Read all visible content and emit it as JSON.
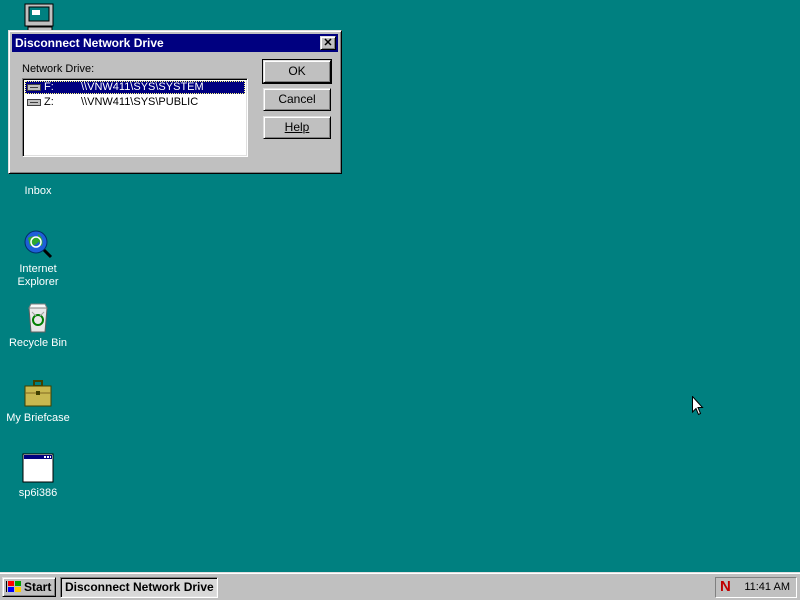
{
  "desktop": {
    "icons": [
      {
        "label": ""
      },
      {
        "label": "Inbox"
      },
      {
        "label": "Internet\nExplorer",
        "line1": "Internet",
        "line2": "Explorer"
      },
      {
        "label": "Recycle Bin"
      },
      {
        "label": "My Briefcase"
      },
      {
        "label": "sp6i386"
      }
    ]
  },
  "dialog": {
    "title": "Disconnect Network Drive",
    "close_label": "✕",
    "list_label": "Network Drive:",
    "drives": [
      {
        "letter": "F:",
        "path": "\\\\VNW411\\SYS\\SYSTEM",
        "selected": true
      },
      {
        "letter": "Z:",
        "path": "\\\\VNW411\\SYS\\PUBLIC",
        "selected": false
      }
    ],
    "ok_label": "OK",
    "cancel_label": "Cancel",
    "help_label": "Help"
  },
  "taskbar": {
    "start_label": "Start",
    "task_label": "Disconnect Network Drive",
    "tray_icon": "N",
    "clock": "11:41 AM"
  },
  "colors": {
    "desktop": "#008080",
    "title_active": "#000080",
    "face": "#c0c0c0"
  }
}
